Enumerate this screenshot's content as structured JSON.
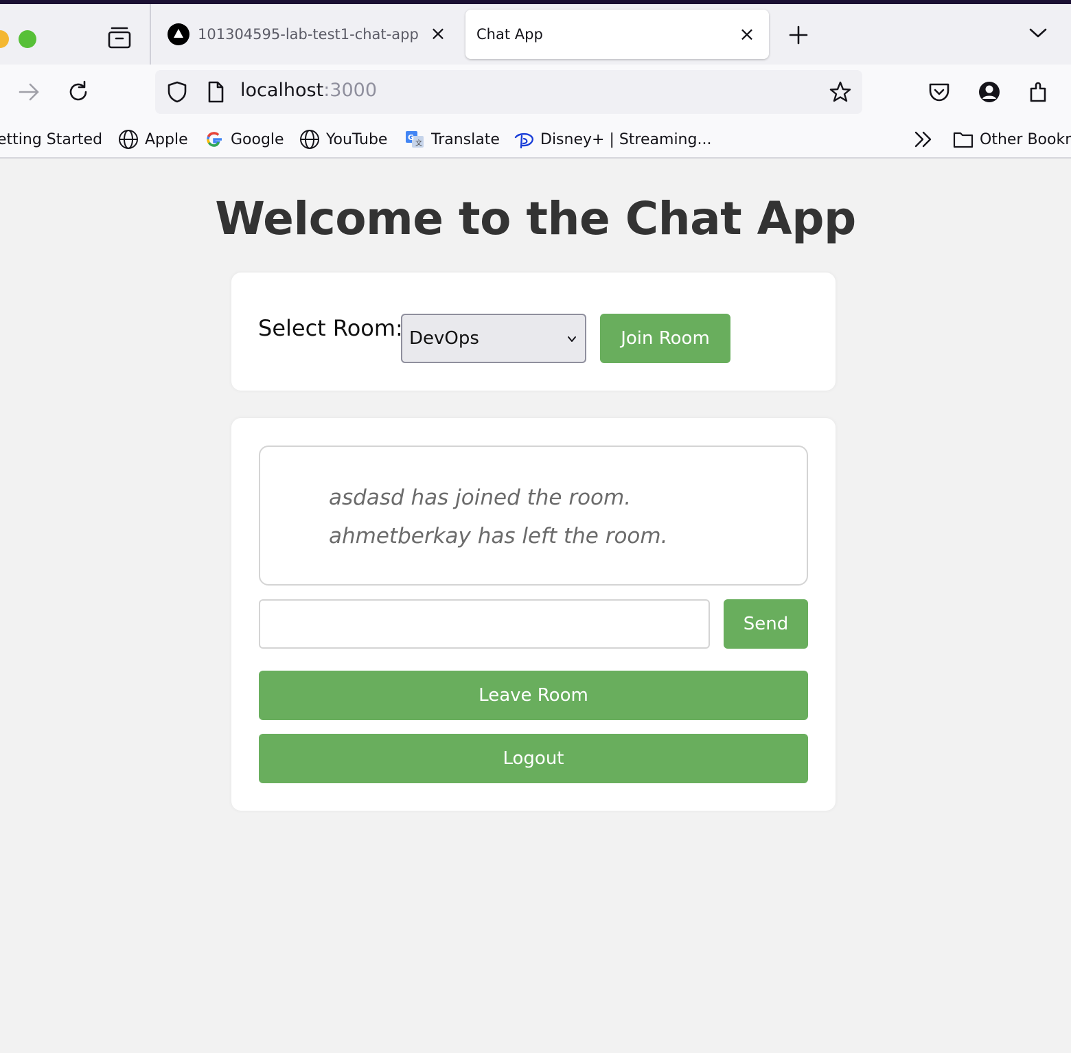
{
  "browser": {
    "tabs": [
      {
        "title": "101304595-lab-test1-chat-app",
        "active": false
      },
      {
        "title": "Chat App",
        "active": true
      }
    ],
    "url": {
      "host": "localhost",
      "port": ":3000"
    },
    "bookmarks": [
      {
        "label": "etting Started",
        "icon": "none"
      },
      {
        "label": "Apple",
        "icon": "globe-icon"
      },
      {
        "label": "Google",
        "icon": "google-icon"
      },
      {
        "label": "YouTube",
        "icon": "globe-icon"
      },
      {
        "label": "Translate",
        "icon": "translate-icon"
      },
      {
        "label": "Disney+ | Streaming...",
        "icon": "disney-icon"
      }
    ],
    "other_bookmarks": "Other Bookm",
    "colors": {
      "accent_green": "#69ae5d",
      "page_bg": "#f2f2f2"
    }
  },
  "page": {
    "title": "Welcome to the Chat App",
    "room": {
      "label": "Select Room:",
      "selected": "DevOps",
      "join_label": "Join Room"
    },
    "chat": {
      "messages": [
        "asdasd has joined the room.",
        "ahmetberkay has left the room."
      ],
      "input_value": "",
      "send_label": "Send",
      "leave_label": "Leave Room",
      "logout_label": "Logout"
    }
  }
}
